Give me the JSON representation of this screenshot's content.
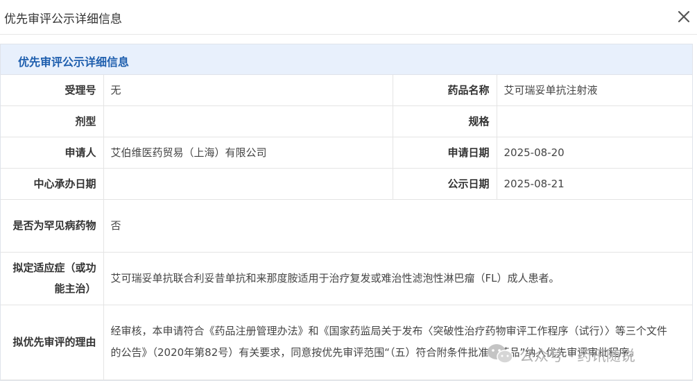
{
  "window": {
    "title": "优先审评公示详细信息"
  },
  "panel": {
    "title": "优先审评公示详细信息"
  },
  "rows": [
    {
      "label": "受理号",
      "value": "无",
      "label2": "药品名称",
      "value2": "艾可瑞妥单抗注射液"
    },
    {
      "label": "剂型",
      "value": "",
      "label2": "规格",
      "value2": ""
    },
    {
      "label": "申请人",
      "value": "艾伯维医药贸易（上海）有限公司",
      "label2": "申请日期",
      "value2": "2025-08-20"
    },
    {
      "label": "中心承办日期",
      "value": "",
      "label2": "公示日期",
      "value2": "2025-08-21"
    }
  ],
  "rare_disease": {
    "label": "是否为罕见病药物",
    "value": "否"
  },
  "indication": {
    "label": "拟定适应症（或功能主治）",
    "value": "艾可瑞妥单抗联合利妥昔单抗和来那度胺适用于治疗复发或难治性滤泡性淋巴瘤（FL）成人患者。"
  },
  "reason": {
    "label": "拟优先审评的理由",
    "value": "经审核，本申请符合《药品注册管理办法》和《国家药监局关于发布〈突破性治疗药物审评工作程序（试行）〉等三个文件的公告》（2020年第82号）有关要求，同意按优先审评范围“（五）符合附条件批准的药品”纳入优先审评审批程序。"
  },
  "watermark": {
    "text": "公众号 · 药讯随说",
    "icon": "wechat-icon"
  }
}
